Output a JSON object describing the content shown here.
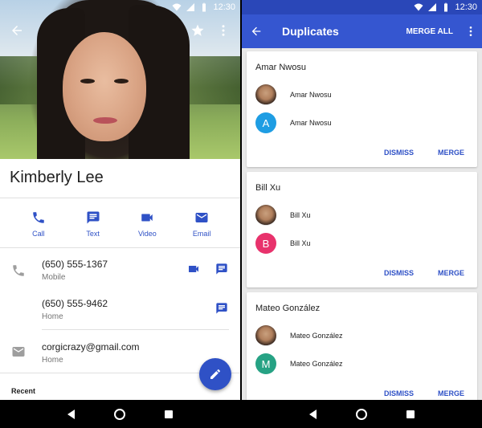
{
  "left": {
    "status": {
      "time": "12:30"
    },
    "contact": {
      "name": "Kimberly Lee"
    },
    "actions": [
      {
        "label": "Call",
        "icon": "phone-icon"
      },
      {
        "label": "Text",
        "icon": "message-icon"
      },
      {
        "label": "Video",
        "icon": "videocam-icon"
      },
      {
        "label": "Email",
        "icon": "email-icon"
      }
    ],
    "phones": [
      {
        "number": "(650) 555-1367",
        "type": "Mobile"
      },
      {
        "number": "(650) 555-9462",
        "type": "Home"
      }
    ],
    "email": {
      "address": "corgicrazy@gmail.com",
      "type": "Home"
    },
    "recent_label": "Recent"
  },
  "right": {
    "status": {
      "time": "12:30"
    },
    "appbar": {
      "title": "Duplicates",
      "merge_all": "MERGE ALL"
    },
    "groups": [
      {
        "name": "Amar Nwosu",
        "entries": [
          {
            "name": "Amar Nwosu",
            "avatar": "photo"
          },
          {
            "name": "Amar Nwosu",
            "avatar": "A",
            "color": "#1e9de3"
          }
        ]
      },
      {
        "name": "Bill Xu",
        "entries": [
          {
            "name": "Bill Xu",
            "avatar": "photo"
          },
          {
            "name": "Bill Xu",
            "avatar": "B",
            "color": "#e8326c"
          }
        ]
      },
      {
        "name": "Mateo González",
        "entries": [
          {
            "name": "Mateo González",
            "avatar": "photo"
          },
          {
            "name": "Mateo González",
            "avatar": "M",
            "color": "#26a284"
          }
        ]
      }
    ],
    "dismiss_label": "DISMISS",
    "merge_label": "MERGE"
  },
  "colors": {
    "primary": "#3556d0",
    "accent": "#2f51c6"
  }
}
